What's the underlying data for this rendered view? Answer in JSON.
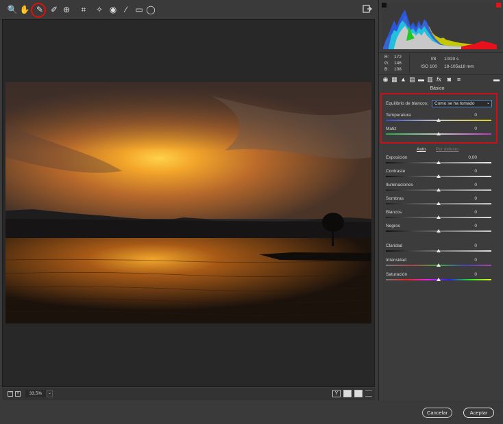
{
  "toolbar": {
    "tools": [
      {
        "name": "zoom-tool",
        "icon": "magnifier-icon",
        "glyph": "🔍"
      },
      {
        "name": "hand-tool",
        "icon": "hand-icon",
        "glyph": "✋"
      },
      {
        "name": "white-balance-tool",
        "icon": "eyedropper-icon",
        "glyph": "✎"
      },
      {
        "name": "color-sampler-tool",
        "icon": "color-sampler-icon",
        "glyph": "✐"
      },
      {
        "name": "targeted-adjustment-tool",
        "icon": "target-adjust-icon",
        "glyph": "⊕"
      },
      {
        "name": "crop-tool",
        "icon": "crop-icon",
        "glyph": "⌗"
      },
      {
        "name": "spot-removal-tool",
        "icon": "spot-removal-icon",
        "glyph": "✧"
      },
      {
        "name": "red-eye-tool",
        "icon": "red-eye-icon",
        "glyph": "◉"
      },
      {
        "name": "adjustment-brush-tool",
        "icon": "brush-icon",
        "glyph": "⁄"
      },
      {
        "name": "graduated-filter-tool",
        "icon": "graduated-filter-icon",
        "glyph": "▭"
      },
      {
        "name": "radial-filter-tool",
        "icon": "radial-filter-icon",
        "glyph": "◯"
      }
    ],
    "open_image_icon": "export-icon"
  },
  "meta": {
    "r_label": "R:",
    "r_value": "172",
    "g_label": "G:",
    "g_value": "146",
    "b_label": "B:",
    "b_value": "108",
    "aperture": "f/8",
    "shutter": "1/320 s",
    "iso": "ISO 100",
    "lens": "18-105a18 mm"
  },
  "panel_tabs": [
    "basic-icon",
    "tone-curve-icon",
    "detail-icon",
    "hsl-icon",
    "split-toning-icon",
    "lens-icon",
    "fx-icon",
    "camera-calibration-icon",
    "presets-icon"
  ],
  "section_title": "Básico",
  "white_balance": {
    "label": "Equilibrio de blancos:",
    "value": "Como se ha tomado"
  },
  "wb_sliders": [
    {
      "label": "Temperatura",
      "value": "0"
    },
    {
      "label": "Matiz",
      "value": "0"
    }
  ],
  "auto_label": "Auto",
  "default_label": "Por defecto",
  "tone_sliders": [
    {
      "label": "Exposición",
      "value": "0,00"
    },
    {
      "label": "Contraste",
      "value": "0"
    },
    {
      "label": "Iluminaciones",
      "value": "0"
    },
    {
      "label": "Sombras",
      "value": "0"
    },
    {
      "label": "Blancos",
      "value": "0"
    },
    {
      "label": "Negros",
      "value": "0"
    }
  ],
  "presence_sliders": [
    {
      "label": "Claridad",
      "value": "0"
    },
    {
      "label": "Intensidad",
      "value": "0"
    },
    {
      "label": "Saturación",
      "value": "0"
    }
  ],
  "statusbar": {
    "zoom": "33,5%"
  },
  "buttons": {
    "cancel": "Cancelar",
    "accept": "Aceptar"
  },
  "colors": {
    "highlight_ring": "#d11",
    "select_border": "#5a86c8"
  }
}
